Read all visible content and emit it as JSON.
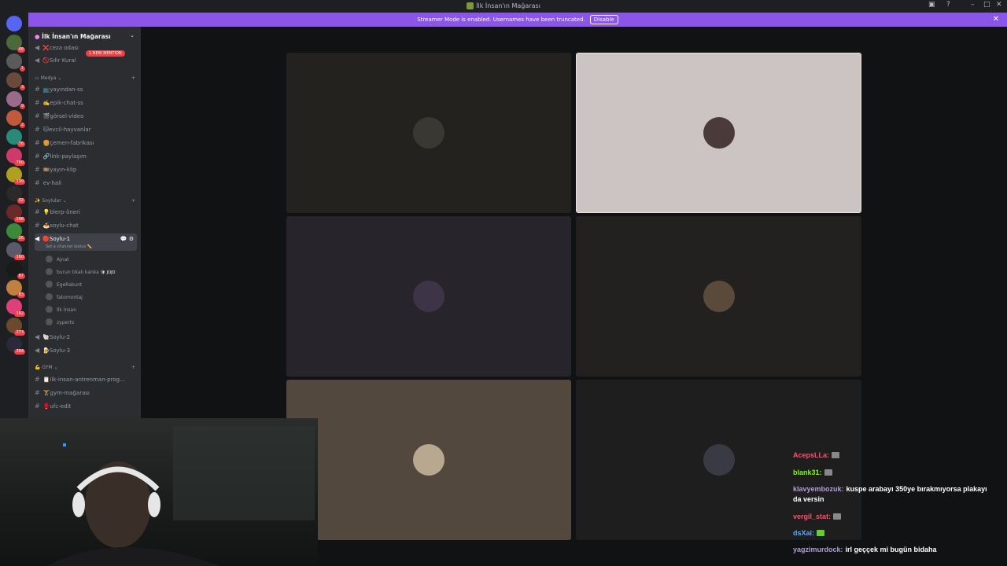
{
  "window": {
    "title": "İlk İnsan'ın Mağarası"
  },
  "banner": {
    "text": "Streamer Mode is enabled. Usernames have been truncated.",
    "disable_label": "Disable"
  },
  "server": {
    "name": "İlk İnsan'ın Mağarası",
    "mention_badge": "1 NEW MENTION"
  },
  "channels_top": [
    {
      "label": "❌ceza odası"
    },
    {
      "label": "🚫Sıfır Kural"
    }
  ],
  "categories": {
    "medya": "Medya",
    "soylular": "Soylular",
    "gym": "GYM"
  },
  "medya_channels": [
    {
      "label": "📺yayından-ss"
    },
    {
      "label": "✍️epik-chat-ss"
    },
    {
      "label": "🎬görsel-video"
    },
    {
      "label": "🐱evcil-hayvanlar"
    },
    {
      "label": "🍔çemen-fabrikası"
    },
    {
      "label": "🔗link-paylaşım"
    },
    {
      "label": "🎞️yayın-klip"
    },
    {
      "label": "ev-hali"
    }
  ],
  "soylular_channels": [
    {
      "label": "💡blerp-öneri"
    },
    {
      "label": "🍝soylu-chat"
    }
  ],
  "voice_active": {
    "label": "🔴Soylu-1",
    "status": "Set a channel status ✏️"
  },
  "members": [
    {
      "name": "Ajnat",
      "tag": ""
    },
    {
      "name": "burun tıkalı kanka",
      "tag": "🛡 JOJO"
    },
    {
      "name": "EgeRakunt",
      "tag": ""
    },
    {
      "name": "fatomontaj",
      "tag": ""
    },
    {
      "name": "İlk İnsan",
      "tag": ""
    },
    {
      "name": "zyperts",
      "tag": ""
    }
  ],
  "voice_more": [
    {
      "label": "🐚Soylu-2"
    },
    {
      "label": "🍺Soylu-3"
    }
  ],
  "gym_channels": [
    {
      "label": "📋ilk-insan-antrenman-prog..."
    },
    {
      "label": "🏋️gym-mağarası"
    },
    {
      "label": "🥊ufc-edit"
    }
  ],
  "guild_badges": [
    "48",
    "1",
    "3",
    "9",
    "2",
    "76",
    "700",
    "139",
    "32",
    "198",
    "26",
    "160",
    "87",
    "83",
    "192",
    "273",
    "394"
  ],
  "guild_label_ikis": "İKİS ADAM",
  "chat": [
    {
      "user": "AcepsLLa:",
      "color": "#ff4f6b",
      "text": "",
      "emote": true
    },
    {
      "user": "blank31:",
      "color": "#7cfc00",
      "text": "",
      "emote": true
    },
    {
      "user": "klavyembozuk:",
      "color": "#b39ddb",
      "text": "kuspe arabayı 350ye bırakmıyorsa plakayı",
      "emote": false
    },
    {
      "user": "",
      "color": "#ffffff",
      "text": "da versin",
      "emote": false
    },
    {
      "user": "vergil_stat:",
      "color": "#ff4f6b",
      "text": "",
      "emote": true
    },
    {
      "user": "dsXai:",
      "color": "#5da9ff",
      "text": "",
      "emote": true
    },
    {
      "user": "yagzimurdock:",
      "color": "#b39ddb",
      "text": "irl geççek mi bugün bidaha",
      "emote": false
    }
  ],
  "colors": {
    "banner": "#8a55e8",
    "sidebar": "#2b2d31",
    "guildbar": "#1e1f22"
  }
}
